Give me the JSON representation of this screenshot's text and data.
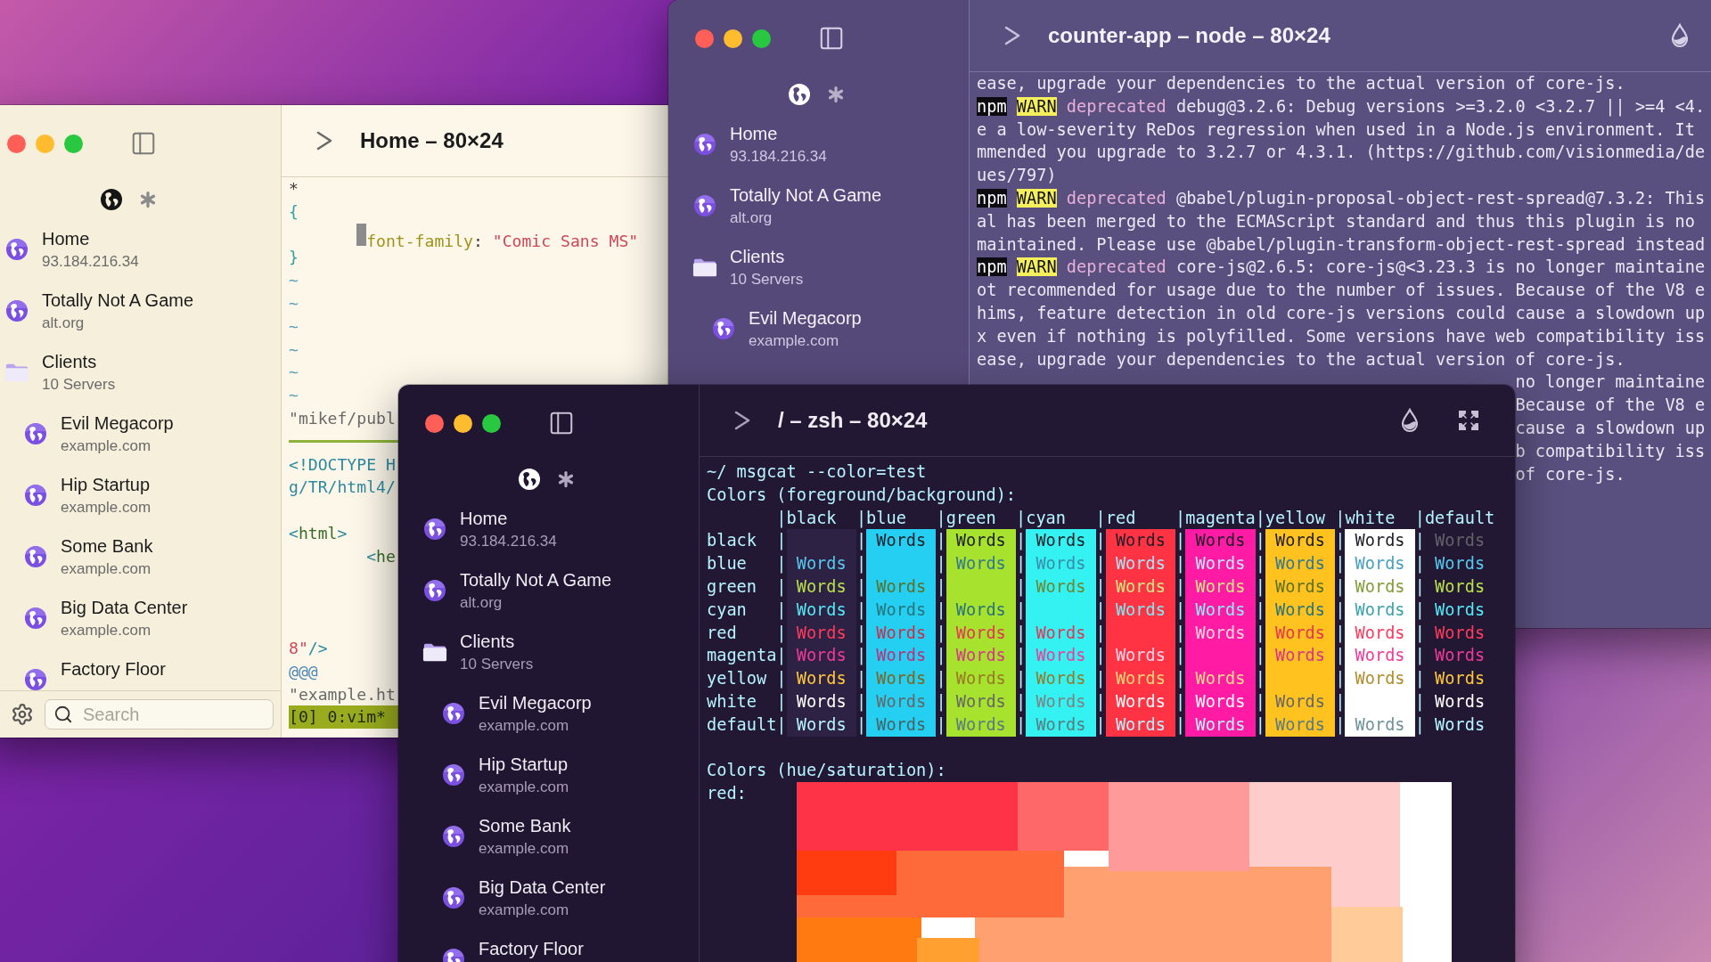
{
  "windows": [
    {
      "kind": "light",
      "title": "Home – 80×24",
      "sidebar": {
        "tabs": [
          {
            "kind": "globe",
            "selected": true
          },
          {
            "kind": "asterisk",
            "selected": false
          }
        ],
        "items": [
          {
            "kind": "server",
            "name": "Home",
            "detail": "93.184.216.34"
          },
          {
            "kind": "server",
            "name": "Totally Not A Game",
            "detail": "alt.org"
          },
          {
            "kind": "folder",
            "name": "Clients",
            "detail": "10 Servers",
            "children": [
              {
                "kind": "server",
                "name": "Evil Megacorp",
                "detail": "example.com"
              },
              {
                "kind": "server",
                "name": "Hip Startup",
                "detail": "example.com"
              },
              {
                "kind": "server",
                "name": "Some Bank",
                "detail": "example.com"
              },
              {
                "kind": "server",
                "name": "Big Data Center",
                "detail": "example.com"
              },
              {
                "kind": "server",
                "name": "Factory Floor"
              }
            ]
          }
        ],
        "search": {
          "placeholder": "Search"
        }
      },
      "content": {
        "kind": "vim",
        "lines": [
          {
            "kind": "code",
            "indented": false,
            "cursor": false,
            "segments": [
              {
                "kind": "plain",
                "text": "*"
              }
            ]
          },
          {
            "kind": "code",
            "indented": false,
            "cursor": false,
            "segments": [
              {
                "kind": "punct",
                "text": "{"
              }
            ]
          },
          {
            "kind": "code",
            "indented": true,
            "cursor": true,
            "segments": [
              {
                "kind": "property",
                "text": "font-family"
              },
              {
                "kind": "plain",
                "text": ":"
              },
              {
                "kind": "string",
                "text": "\"Comic Sans MS\""
              }
            ]
          },
          {
            "kind": "code",
            "indented": false,
            "cursor": false,
            "segments": [
              {
                "kind": "punct",
                "text": "}"
              }
            ]
          },
          {
            "kind": "code",
            "indented": false,
            "cursor": false,
            "segments": [
              {
                "kind": "tilde",
                "text": "~"
              }
            ]
          },
          {
            "kind": "code",
            "indented": false,
            "cursor": false,
            "segments": [
              {
                "kind": "tilde",
                "text": "~"
              }
            ]
          },
          {
            "kind": "code",
            "indented": false,
            "cursor": false,
            "segments": [
              {
                "kind": "tilde",
                "text": "~"
              }
            ]
          },
          {
            "kind": "code",
            "indented": false,
            "cursor": false,
            "segments": [
              {
                "kind": "tilde",
                "text": "~"
              }
            ]
          },
          {
            "kind": "code",
            "indented": false,
            "cursor": false,
            "segments": [
              {
                "kind": "tilde",
                "text": "~"
              }
            ]
          },
          {
            "kind": "code",
            "indented": false,
            "cursor": false,
            "segments": [
              {
                "kind": "tilde",
                "text": "~"
              }
            ]
          },
          {
            "kind": "code",
            "indented": false,
            "cursor": false,
            "segments": [
              {
                "kind": "muted",
                "text": "\"mikef/publ"
              }
            ]
          },
          {
            "kind": "rule"
          },
          {
            "kind": "code",
            "indented": false,
            "cursor": false,
            "segments": [
              {
                "kind": "tag",
                "text": "<!DOCTYPE H"
              }
            ]
          },
          {
            "kind": "code",
            "indented": false,
            "cursor": false,
            "segments": [
              {
                "kind": "tag",
                "text": "g/TR/html4/"
              }
            ]
          },
          {
            "kind": "blank"
          },
          {
            "kind": "code",
            "indented": false,
            "cursor": false,
            "segments": [
              {
                "kind": "tag",
                "text": "<"
              },
              {
                "kind": "element",
                "text": "html"
              },
              {
                "kind": "tag",
                "text": ">"
              }
            ]
          },
          {
            "kind": "code",
            "indented": true,
            "cursor": false,
            "segments": [
              {
                "kind": "tag",
                "text": "<"
              },
              {
                "kind": "element",
                "text": "he"
              }
            ]
          },
          {
            "kind": "blank"
          },
          {
            "kind": "blank"
          },
          {
            "kind": "blank"
          },
          {
            "kind": "code",
            "indented": false,
            "cursor": false,
            "segments": [
              {
                "kind": "string",
                "text": "8\""
              },
              {
                "kind": "tag",
                "text": "/>"
              }
            ]
          },
          {
            "kind": "code",
            "indented": false,
            "cursor": false,
            "segments": [
              {
                "kind": "special",
                "text": "@@@"
              }
            ]
          },
          {
            "kind": "code",
            "indented": false,
            "cursor": false,
            "segments": [
              {
                "kind": "muted",
                "text": "\"example.ht"
              }
            ]
          },
          {
            "kind": "status",
            "text": "[0] 0:vim*"
          }
        ]
      }
    },
    {
      "kind": "dusk",
      "title": "counter-app – node – 80×24",
      "tools": [
        {
          "kind": "theme"
        }
      ],
      "sidebar": {
        "tabs": [
          {
            "kind": "globe",
            "selected": true
          },
          {
            "kind": "asterisk",
            "selected": false
          }
        ],
        "items": [
          {
            "kind": "server",
            "name": "Home",
            "detail": "93.184.216.34"
          },
          {
            "kind": "server",
            "name": "Totally Not A Game",
            "detail": "alt.org"
          },
          {
            "kind": "folder",
            "name": "Clients",
            "detail": "10 Servers",
            "children": [
              {
                "kind": "server",
                "name": "Evil Megacorp",
                "detail": "example.com"
              }
            ]
          }
        ]
      },
      "content": {
        "kind": "log",
        "lines": [
          {
            "kind": "plain",
            "text": "ease, upgrade your dependencies to the actual version of core-js."
          },
          {
            "kind": "warn",
            "source": "npm",
            "tag": "WARN",
            "status": "deprecated",
            "text": "debug@3.2.6: Debug versions >=3.2.0 <3.2.7 || >=4 <4."
          },
          {
            "kind": "plain",
            "text": "e a low-severity ReDos regression when used in a Node.js environment. It"
          },
          {
            "kind": "plain",
            "text": "mmended you upgrade to 3.2.7 or 4.3.1. (https://github.com/visionmedia/de"
          },
          {
            "kind": "plain",
            "text": "ues/797)"
          },
          {
            "kind": "warn",
            "source": "npm",
            "tag": "WARN",
            "status": "deprecated",
            "text": "@babel/plugin-proposal-object-rest-spread@7.3.2: This"
          },
          {
            "kind": "plain",
            "text": "al has been merged to the ECMAScript standard and thus this plugin is no"
          },
          {
            "kind": "plain",
            "text": "maintained. Please use @babel/plugin-transform-object-rest-spread instead"
          },
          {
            "kind": "warn",
            "source": "npm",
            "tag": "WARN",
            "status": "deprecated",
            "text": "core-js@2.6.5: core-js@<3.23.3 is no longer maintaine"
          },
          {
            "kind": "plain",
            "text": "ot recommended for usage due to the number of issues. Because of the V8 e"
          },
          {
            "kind": "plain",
            "text": "hims, feature detection in old core-js versions could cause a slowdown up"
          },
          {
            "kind": "plain",
            "text": "x even if nothing is polyfilled. Some versions have web compatibility iss"
          },
          {
            "kind": "plain",
            "text": "ease, upgrade your dependencies to the actual version of core-js."
          }
        ],
        "tail_lines": [
          "no longer maintaine",
          "Because of the V8 e",
          "cause a slowdown up",
          "b compatibility iss",
          "of core-js."
        ]
      }
    },
    {
      "kind": "dark",
      "title": "/ – zsh – 80×24",
      "tools": [
        {
          "kind": "theme"
        },
        {
          "kind": "fullscreen"
        }
      ],
      "sidebar": {
        "tabs": [
          {
            "kind": "globe",
            "selected": true
          },
          {
            "kind": "asterisk",
            "selected": false
          }
        ],
        "items": [
          {
            "kind": "server",
            "name": "Home",
            "detail": "93.184.216.34"
          },
          {
            "kind": "server",
            "name": "Totally Not A Game",
            "detail": "alt.org"
          },
          {
            "kind": "folder",
            "name": "Clients",
            "detail": "10 Servers",
            "children": [
              {
                "kind": "server",
                "name": "Evil Megacorp",
                "detail": "example.com"
              },
              {
                "kind": "server",
                "name": "Hip Startup",
                "detail": "example.com"
              },
              {
                "kind": "server",
                "name": "Some Bank",
                "detail": "example.com"
              },
              {
                "kind": "server",
                "name": "Big Data Center",
                "detail": "example.com"
              },
              {
                "kind": "server",
                "name": "Factory Floor"
              }
            ]
          }
        ]
      },
      "content": {
        "kind": "colortest",
        "command": "~/ msgcat --color=test",
        "heading": "Colors (foreground/background):",
        "columns": [
          {
            "label": "|black",
            "color": "#2e2244"
          },
          {
            "label": "|blue",
            "color": "#24cff2"
          },
          {
            "label": "|green",
            "color": "#a6e22e"
          },
          {
            "label": "|cyan",
            "color": "#34f2f2"
          },
          {
            "label": "|red",
            "color": "#ff3344"
          },
          {
            "label": "|magenta",
            "color": "#ff1ba4"
          },
          {
            "label": "|yellow",
            "color": "#ffc21e"
          },
          {
            "label": "|white",
            "color": "#ffffff"
          },
          {
            "label": "|default"
          }
        ],
        "rows": [
          {
            "label": "black",
            "color": "#1e1e28",
            "cells": [
              {
                "divider": "|"
              },
              {
                "divider": "|",
                "text": "Words"
              },
              {
                "divider": "|",
                "text": "Words"
              },
              {
                "divider": "|",
                "text": "Words"
              },
              {
                "divider": "|",
                "text": "Words"
              },
              {
                "divider": "|",
                "text": "Words"
              },
              {
                "divider": "|",
                "text": "Words"
              },
              {
                "divider": "|",
                "text": "Words"
              },
              {
                "divider": "|",
                "text": "Words"
              }
            ]
          },
          {
            "label": "blue",
            "color": "#56c8ee",
            "cells": [
              {
                "divider": "|",
                "text": "Words"
              },
              {
                "divider": "|"
              },
              {
                "divider": "|",
                "text": "Words"
              },
              {
                "divider": "|",
                "text": "Words"
              },
              {
                "divider": "|",
                "text": "Words"
              },
              {
                "divider": "|",
                "text": "Words"
              },
              {
                "divider": "|",
                "text": "Words"
              },
              {
                "divider": "|",
                "text": "Words"
              },
              {
                "divider": "|",
                "text": "Words"
              }
            ]
          },
          {
            "label": "green",
            "color": "#b8e04c",
            "cells": [
              {
                "divider": "|",
                "text": "Words"
              },
              {
                "divider": "|",
                "text": "Words"
              },
              {
                "divider": "|"
              },
              {
                "divider": "|",
                "text": "Words"
              },
              {
                "divider": "|",
                "text": "Words"
              },
              {
                "divider": "|",
                "text": "Words"
              },
              {
                "divider": "|",
                "text": "Words"
              },
              {
                "divider": "|",
                "text": "Words"
              },
              {
                "divider": "|",
                "text": "Words"
              }
            ]
          },
          {
            "label": "cyan",
            "color": "#52e8f4",
            "cells": [
              {
                "divider": "|",
                "text": "Words"
              },
              {
                "divider": "|",
                "text": "Words"
              },
              {
                "divider": "|",
                "text": "Words"
              },
              {
                "divider": "|"
              },
              {
                "divider": "|",
                "text": "Words"
              },
              {
                "divider": "|",
                "text": "Words"
              },
              {
                "divider": "|",
                "text": "Words"
              },
              {
                "divider": "|",
                "text": "Words"
              },
              {
                "divider": "|",
                "text": "Words"
              }
            ]
          },
          {
            "label": "red",
            "color": "#ff3a5c",
            "cells": [
              {
                "divider": "|",
                "text": "Words"
              },
              {
                "divider": "|",
                "text": "Words"
              },
              {
                "divider": "|",
                "text": "Words"
              },
              {
                "divider": "|",
                "text": "Words"
              },
              {
                "divider": "|"
              },
              {
                "divider": "|",
                "text": "Words"
              },
              {
                "divider": "|",
                "text": "Words"
              },
              {
                "divider": "|",
                "text": "Words"
              },
              {
                "divider": "|",
                "text": "Words"
              }
            ]
          },
          {
            "label": "magenta",
            "color": "#f03a9a",
            "cells": [
              {
                "divider": "|",
                "text": "Words"
              },
              {
                "divider": "|",
                "text": "Words"
              },
              {
                "divider": "|",
                "text": "Words"
              },
              {
                "divider": "|",
                "text": "Words"
              },
              {
                "divider": "|",
                "text": "Words"
              },
              {
                "divider": "|"
              },
              {
                "divider": "|",
                "text": "Words"
              },
              {
                "divider": "|",
                "text": "Words"
              },
              {
                "divider": "|",
                "text": "Words"
              }
            ]
          },
          {
            "label": "yellow",
            "color": "#ffc83c",
            "cells": [
              {
                "divider": "|",
                "text": "Words"
              },
              {
                "divider": "|",
                "text": "Words"
              },
              {
                "divider": "|",
                "text": "Words"
              },
              {
                "divider": "|",
                "text": "Words"
              },
              {
                "divider": "|",
                "text": "Words"
              },
              {
                "divider": "|",
                "text": "Words"
              },
              {
                "divider": "|"
              },
              {
                "divider": "|",
                "text": "Words"
              },
              {
                "divider": "|",
                "text": "Words"
              }
            ]
          },
          {
            "label": "white",
            "color": "#ffffff",
            "cells": [
              {
                "divider": "|",
                "text": "Words"
              },
              {
                "divider": "|",
                "text": "Words"
              },
              {
                "divider": "|",
                "text": "Words"
              },
              {
                "divider": "|",
                "text": "Words"
              },
              {
                "divider": "|",
                "text": "Words"
              },
              {
                "divider": "|",
                "text": "Words"
              },
              {
                "divider": "|",
                "text": "Words"
              },
              {
                "divider": "|"
              },
              {
                "divider": "|",
                "text": "Words"
              }
            ]
          },
          {
            "label": "default",
            "color": "#b6f4ff",
            "cells": [
              {
                "divider": "|",
                "text": "Words"
              },
              {
                "divider": "|",
                "text": "Words"
              },
              {
                "divider": "|",
                "text": "Words"
              },
              {
                "divider": "|",
                "text": "Words"
              },
              {
                "divider": "|",
                "text": "Words"
              },
              {
                "divider": "|",
                "text": "Words"
              },
              {
                "divider": "|",
                "text": "Words"
              },
              {
                "divider": "|",
                "text": "Words"
              },
              {
                "divider": "|",
                "text": "Words"
              }
            ]
          }
        ],
        "hue_heading": "Colors (hue/saturation):",
        "hue_label": "red:"
      }
    }
  ]
}
